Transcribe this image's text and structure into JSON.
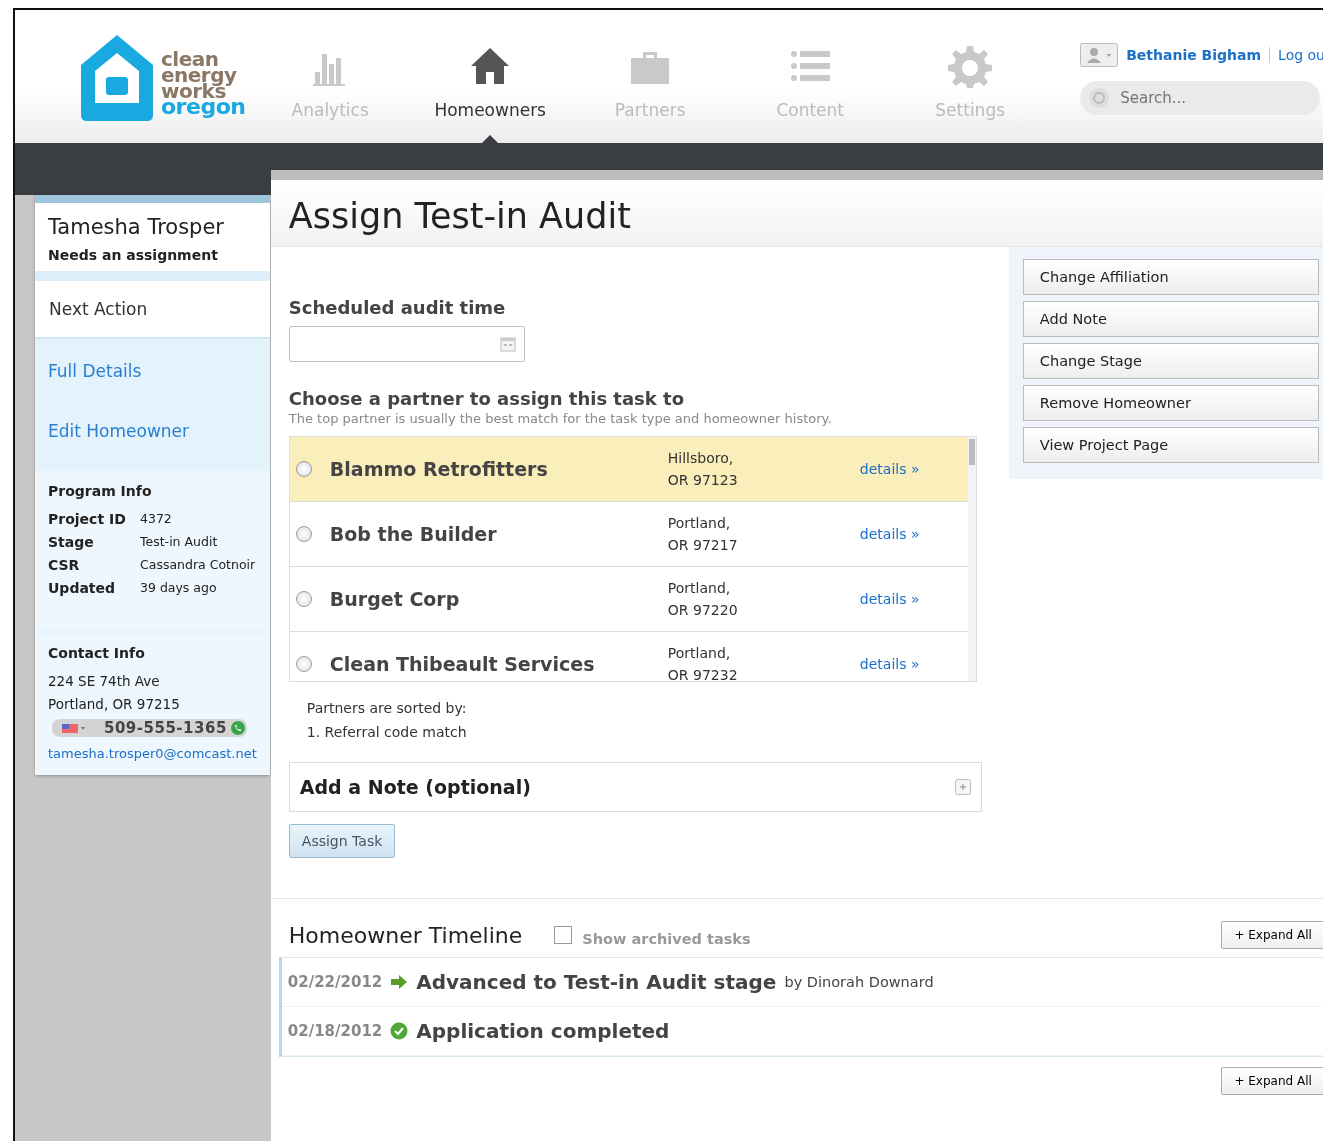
{
  "logo": {
    "lines": [
      "clean",
      "energy",
      "works",
      "oregon"
    ]
  },
  "nav": [
    {
      "label": "Analytics",
      "kind": "analytics",
      "selected": false
    },
    {
      "label": "Homeowners",
      "kind": "home",
      "selected": true
    },
    {
      "label": "Partners",
      "kind": "briefcase",
      "selected": false
    },
    {
      "label": "Content",
      "kind": "list",
      "selected": false
    },
    {
      "label": "Settings",
      "kind": "gear",
      "selected": false
    }
  ],
  "user": {
    "name": "Bethanie Bigham",
    "logout": "Log ou"
  },
  "search": {
    "placeholder": "Search..."
  },
  "sidebar": {
    "name": "Tamesha Trosper",
    "status": "Needs an assignment",
    "next_action": "Next Action",
    "links": [
      "Full Details",
      "Edit Homeowner"
    ],
    "program_info": {
      "title": "Program Info",
      "rows": [
        {
          "label": "Project ID",
          "value": "4372"
        },
        {
          "label": "Stage",
          "value": "Test-in Audit"
        },
        {
          "label": "CSR",
          "value": "Cassandra Cotnoir"
        },
        {
          "label": "Updated",
          "value": "39 days ago"
        }
      ]
    },
    "contact_info": {
      "title": "Contact Info",
      "address": [
        "224 SE 74th Ave",
        "Portland, OR 97215"
      ],
      "phone": "509-555-1365",
      "email": "tamesha.trosper0@comcast.net"
    }
  },
  "main": {
    "title": "Assign Test-in Audit",
    "audit_time": {
      "label": "Scheduled audit time"
    },
    "partner_section": {
      "title": "Choose a partner to assign this task to",
      "hint": "The top partner is usually the best match for the task type and homeowner history."
    },
    "partners": [
      {
        "name": "Blammo Retrofitters",
        "city": "Hillsboro,",
        "zip": "OR 97123",
        "link": "details »",
        "highlighted": true,
        "selected": false
      },
      {
        "name": "Bob the Builder",
        "city": "Portland,",
        "zip": "OR 97217",
        "link": "details »",
        "highlighted": false,
        "selected": false
      },
      {
        "name": "Burget Corp",
        "city": "Portland,",
        "zip": "OR 97220",
        "link": "details »",
        "highlighted": false,
        "selected": false
      },
      {
        "name": "Clean Thibeault Services",
        "city": "Portland,",
        "zip": "OR 97232",
        "link": "details »",
        "highlighted": false,
        "selected": false
      }
    ],
    "sort_note": [
      "Partners are sorted by:",
      "1. Referral code match"
    ],
    "note": {
      "title": "Add a Note (optional)",
      "expanded": false
    },
    "assign_button": "Assign Task",
    "actions": [
      "Change Affiliation",
      "Add Note",
      "Change Stage",
      "Remove Homeowner",
      "View Project Page"
    ]
  },
  "timeline": {
    "title": "Homeowner Timeline",
    "archived": {
      "label": "Show archived tasks",
      "checked": false
    },
    "expand": "+ Expand All",
    "items": [
      {
        "date": "02/22/2012",
        "kind": "advanced",
        "text": "Advanced to Test-in Audit stage",
        "by": "by Dinorah Downard"
      },
      {
        "date": "02/18/2012",
        "kind": "completed",
        "text": "Application completed"
      }
    ],
    "expand_bottom": "+ Expand All"
  }
}
